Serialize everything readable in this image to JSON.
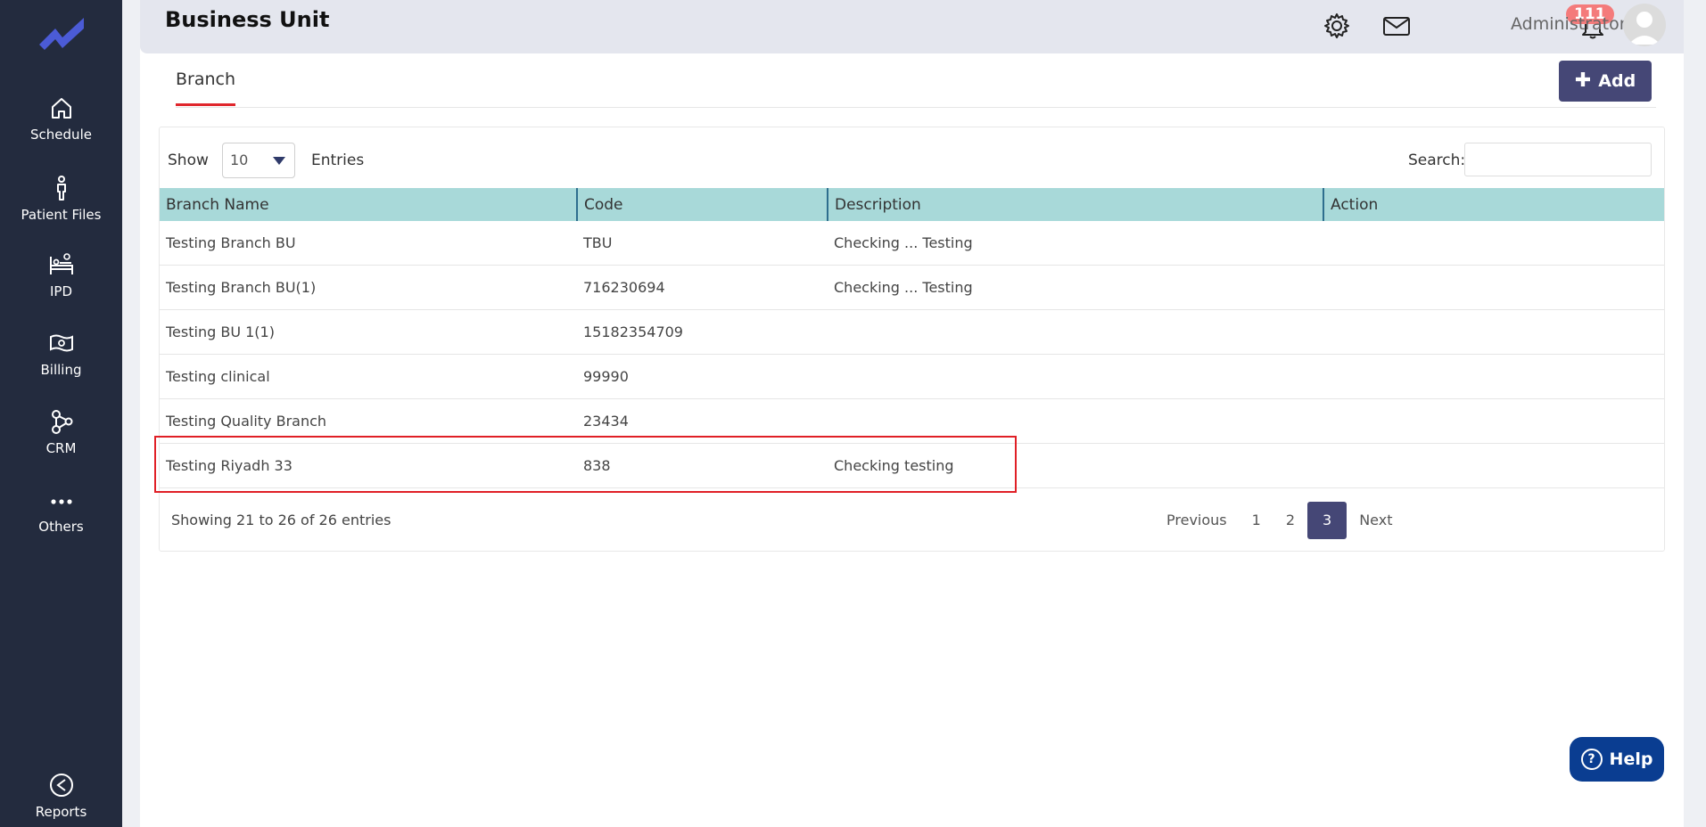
{
  "sidebar": {
    "items": [
      {
        "label": "Schedule",
        "icon": "home-icon"
      },
      {
        "label": "Patient Files",
        "icon": "person-icon"
      },
      {
        "label": "IPD",
        "icon": "bed-icon"
      },
      {
        "label": "Billing",
        "icon": "billing-icon"
      },
      {
        "label": "CRM",
        "icon": "crm-icon"
      },
      {
        "label": "Others",
        "icon": "more-icon"
      },
      {
        "label": "Reports",
        "icon": "reports-icon"
      }
    ]
  },
  "header": {
    "title": "Business Unit",
    "notification_count": "111",
    "user_name": "Administrator"
  },
  "tabs": [
    {
      "label": "Branch",
      "active": true
    }
  ],
  "toolbar": {
    "add_label": "Add"
  },
  "table_controls": {
    "show_label": "Show",
    "page_size": "10",
    "entries_label": "Entries",
    "search_label": "Search:",
    "search_value": ""
  },
  "table": {
    "columns": [
      "Branch Name",
      "Code",
      "Description",
      "Action"
    ],
    "rows": [
      [
        "Testing Branch BU",
        "TBU",
        "Checking ... Testing",
        ""
      ],
      [
        "Testing Branch BU(1)",
        "716230694",
        "Checking ... Testing",
        ""
      ],
      [
        "Testing BU 1(1)",
        "15182354709",
        "",
        ""
      ],
      [
        "Testing clinical",
        "99990",
        "",
        ""
      ],
      [
        "Testing Quality Branch",
        "23434",
        "",
        ""
      ],
      [
        "Testing Riyadh 33",
        "838",
        "Checking testing",
        ""
      ]
    ]
  },
  "pagination": {
    "info": "Showing 21 to 26 of 26 entries",
    "previous": "Previous",
    "pages": [
      "1",
      "2",
      "3"
    ],
    "current": "3",
    "next": "Next"
  },
  "help": {
    "label": "Help"
  },
  "colors": {
    "sidebar_bg": "#232b3e",
    "accent": "#454776",
    "table_header": "#a8d9d9",
    "tab_underline": "#e0262c",
    "badge": "#f47b7b",
    "help_bg": "#0a3d91"
  }
}
